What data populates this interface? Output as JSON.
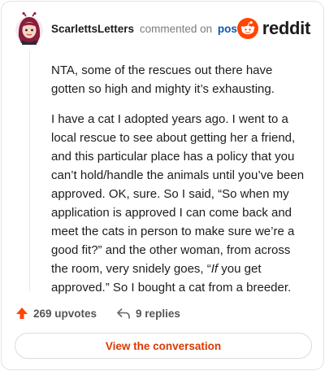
{
  "header": {
    "username": "ScarlettsLetters",
    "verb": "commented on",
    "target": "post",
    "brand": "reddit"
  },
  "comment": {
    "paragraphs": [
      "NTA, some of the rescues out there have gotten so high and mighty it’s exhausting.",
      "I have a cat I adopted years ago. I went to a local rescue to see about getting her a friend, and this particular place has a policy that you can’t hold/handle the animals until you’ve been approved. OK, sure. So I said, “So when my application is approved I can come back and meet the cats in person to make sure we’re a good fit?” and the other woman, from across the room, very snidely goes, “",
      "If",
      " you get approved.” So I bought a cat from a breeder."
    ]
  },
  "actions": {
    "upvotes": "269 upvotes",
    "replies": "9 replies"
  },
  "cta": {
    "label": "View the conversation"
  },
  "colors": {
    "accent": "#ff4500",
    "link": "#0b57b8",
    "cta_text": "#d93900"
  }
}
